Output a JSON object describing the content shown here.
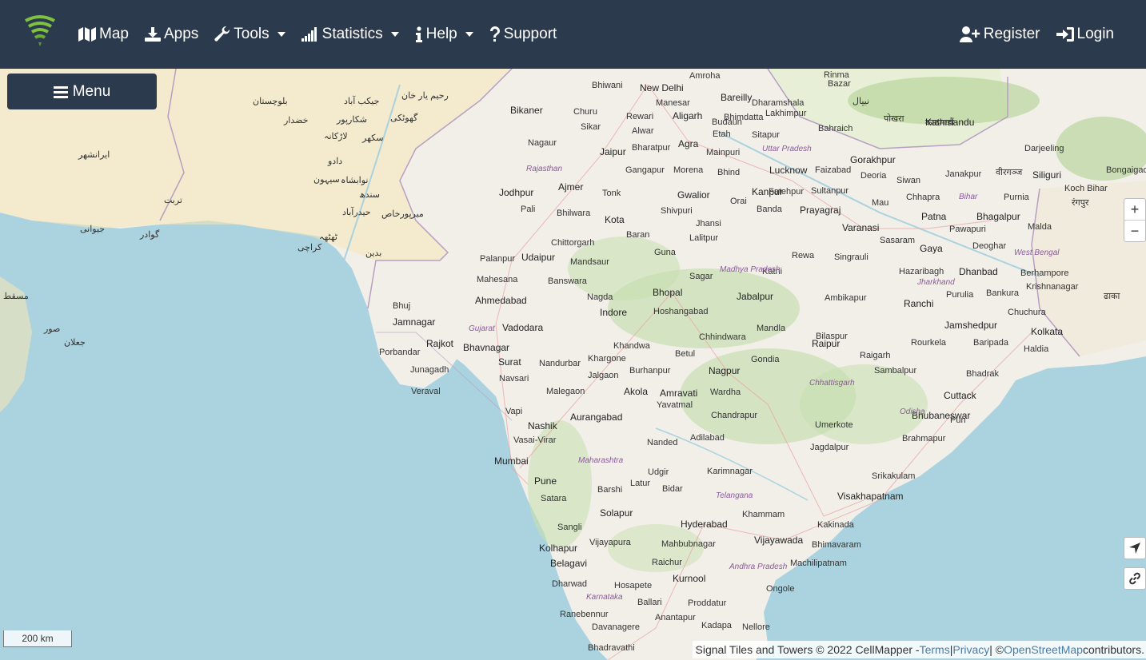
{
  "nav": {
    "left": [
      {
        "id": "map",
        "label": "Map",
        "icon": "map-icon",
        "dropdown": false
      },
      {
        "id": "apps",
        "label": "Apps",
        "icon": "download-icon",
        "dropdown": false
      },
      {
        "id": "tools",
        "label": "Tools",
        "icon": "wrench-icon",
        "dropdown": true
      },
      {
        "id": "statistics",
        "label": "Statistics",
        "icon": "signal-bars-icon",
        "dropdown": true
      },
      {
        "id": "help",
        "label": "Help",
        "icon": "info-icon",
        "dropdown": true
      },
      {
        "id": "support",
        "label": "Support",
        "icon": "question-icon",
        "dropdown": false
      }
    ],
    "right": [
      {
        "id": "register",
        "label": "Register",
        "icon": "user-plus-icon"
      },
      {
        "id": "login",
        "label": "Login",
        "icon": "sign-in-icon"
      }
    ]
  },
  "menu_button": {
    "label": "Menu",
    "icon": "hamburger-icon"
  },
  "zoom": {
    "in": "+",
    "out": "−"
  },
  "scale": "200 km",
  "attribution": {
    "prefix": "Signal Tiles and Towers © 2022 CellMapper - ",
    "terms": "Terms",
    "sep1": " | ",
    "privacy": "Privacy",
    "sep2": " | © ",
    "osm": "OpenStreetMap",
    "suffix": " contributors."
  },
  "map_labels": {
    "cities_major": [
      "New Delhi",
      "Jaipur",
      "Lucknow",
      "Jodhpur",
      "Ahmedabad",
      "Vadodara",
      "Rajkot",
      "Bhopal",
      "Indore",
      "Jabalpur",
      "Nagpur",
      "Mumbai",
      "Pune",
      "Nashik",
      "Aurangabad",
      "Hyderabad",
      "Vijayawada",
      "Visakhapatnam",
      "Kolkata",
      "Patna",
      "Varanasi",
      "Prayagraj",
      "Agra",
      "Gwalior",
      "Jamnagar",
      "Bhavnagar",
      "Surat",
      "Solapur",
      "Kota",
      "Udaipur",
      "Bikaner",
      "Ajmer",
      "Raipur",
      "Cuttack",
      "Bhubaneswar",
      "Ranchi",
      "Jamshedpur",
      "Dhanbad",
      "Gaya",
      "Bhagalpur",
      "Gorakhpur",
      "Kanpur",
      "Bareilly",
      "Aligarh",
      "Amravati",
      "Akola",
      "Belagavi",
      "Kolhapur",
      "Kurnool",
      "Siliguri",
      "Kathmandu"
    ],
    "cities_minor": [
      "Bhiwani",
      "Rewari",
      "Manesar",
      "Alwar",
      "Churu",
      "Sikar",
      "Nagaur",
      "Bharatpur",
      "Gangapur",
      "Morena",
      "Mainpuri",
      "Etah",
      "Budaun",
      "Bhind",
      "Sitapur",
      "Lakhimpur",
      "Bahraich",
      "Faizabad",
      "Tonk",
      "Pali",
      "Bhilwara",
      "Baran",
      "Shivpuri",
      "Jhansi",
      "Lalitpur",
      "Orai",
      "Banda",
      "Fatehpur",
      "Sultanpur",
      "Deoria",
      "Siwan",
      "Chhapra",
      "Mau",
      "Sasaram",
      "Deoghar",
      "Chittorgarh",
      "Mandsaur",
      "Palanpur",
      "Mahesana",
      "Banswara",
      "Nagda",
      "Guna",
      "Sagar",
      "Katni",
      "Rewa",
      "Singrauli",
      "Hoshangabad",
      "Bhuj",
      "Porbandar",
      "Junagadh",
      "Veraval",
      "Navsari",
      "Vapi",
      "Vasai-Virar",
      "Nandurbar",
      "Malegaon",
      "Khargone",
      "Jalgaon",
      "Burhanpur",
      "Khandwa",
      "Betul",
      "Chhindwara",
      "Mandla",
      "Bilaspur",
      "Gondia",
      "Wardha",
      "Yavatmal",
      "Chandrapur",
      "Nanded",
      "Adilabad",
      "Latur",
      "Udgir",
      "Bidar",
      "Barshi",
      "Satara",
      "Sangli",
      "Vijayapura",
      "Karimnagar",
      "Khammam",
      "Mahbubnagar",
      "Raichur",
      "Hosapete",
      "Ballari",
      "Anantapur",
      "Kadapa",
      "Nellore",
      "Ongole",
      "Machilipatnam",
      "Bhimavaram",
      "Kakinada",
      "Srikakulam",
      "Brahmapur",
      "Puri",
      "Umerkote",
      "Jagdalpur",
      "Rourkela",
      "Sambalpur",
      "Raigarh",
      "Bhadrak",
      "Baripada",
      "Haldia",
      "Purulia",
      "Bankura",
      "Chuchura",
      "Hazaribagh",
      "Krishnanagar",
      "Berhampore",
      "Malda",
      "Purnia",
      "Darjeeling",
      "Janakpur",
      "Koch Bihar",
      "Bongaigaon",
      "Pawapuri",
      "Ambikapur",
      "Dharwad",
      "Davanagere",
      "Ranebennur",
      "Bhadravathi",
      "Proddatur",
      "Amroha",
      "Rinma",
      "Bazar",
      "Bhimdatta",
      "Dharamshala"
    ],
    "regions": [
      "Rajasthan",
      "Uttar Pradesh",
      "Madhya Pradesh",
      "Gujarat",
      "Maharashtra",
      "Telangana",
      "Karnataka",
      "Andhra Pradesh",
      "Chhattisgarh",
      "Odisha",
      "Jharkhand",
      "Bihar",
      "West Bengal"
    ],
    "foreign": [
      "کراچی",
      "سکھر",
      "حیدرآباد",
      "رحیم یار خان",
      "بلوچستان",
      "جیکب آباد",
      "لاڑکانہ",
      "خضدار",
      "شکارپور",
      "گھوٹکی",
      "دادو",
      "نوابشاہ",
      "سیہون",
      "ٹھٹھہ",
      "بدین",
      "میرپورخاص",
      "سندھ",
      "گوادر",
      "تربت",
      "جیوانی",
      "ایرانشهر",
      "مسقط",
      "صور",
      "جعلان",
      "نیپال",
      "पोखरा",
      "काठमाडौं",
      "वीरगञ्ज",
      "रंगपुर",
      "ढाका"
    ]
  },
  "colors": {
    "navbar": "#2c3a4d",
    "sea": "#aad3df",
    "land": "#f2efe9",
    "forest": "#c8dfb0",
    "pakistan": "#f5e6b8",
    "accent_logo": "#7fc241"
  }
}
